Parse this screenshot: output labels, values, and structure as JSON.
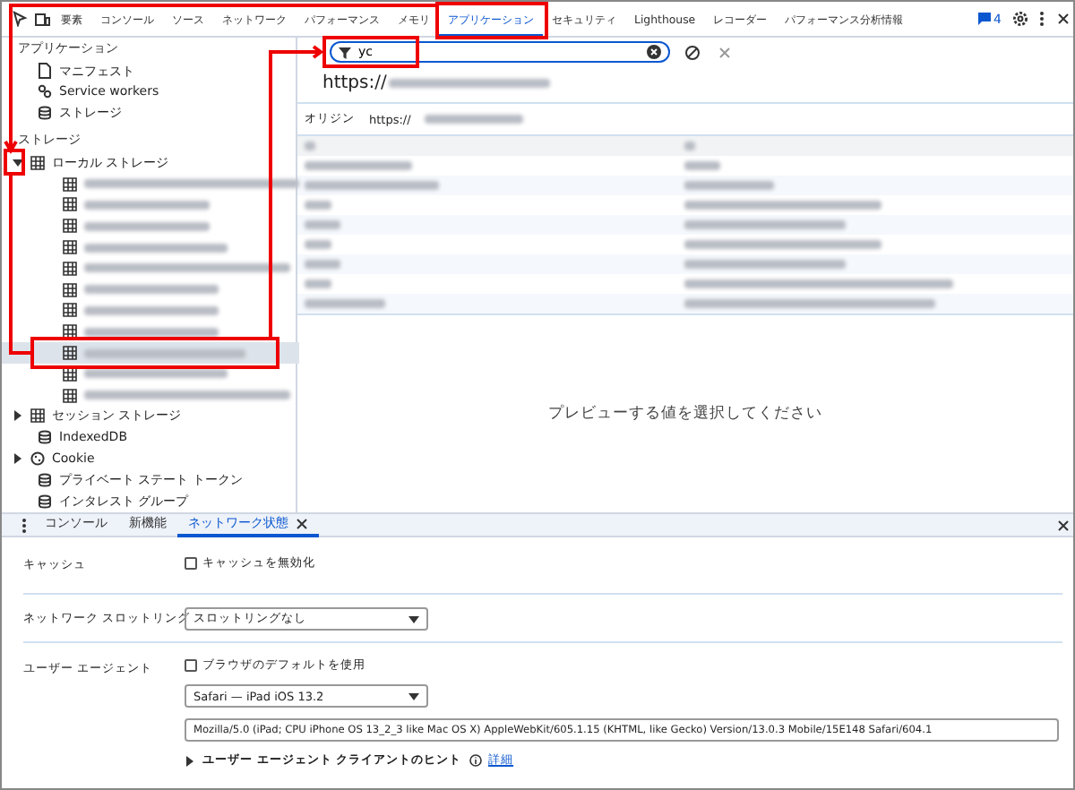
{
  "main_tabs": [
    {
      "label": "要素",
      "selected": false
    },
    {
      "label": "コンソール",
      "selected": false
    },
    {
      "label": "ソース",
      "selected": false
    },
    {
      "label": "ネットワーク",
      "selected": false
    },
    {
      "label": "パフォーマンス",
      "selected": false
    },
    {
      "label": "メモリ",
      "selected": false
    },
    {
      "label": "アプリケーション",
      "selected": true
    },
    {
      "label": "セキュリティ",
      "selected": false
    },
    {
      "label": "Lighthouse",
      "selected": false
    },
    {
      "label": "レコーダー",
      "selected": false
    },
    {
      "label": "パフォーマンス分析情報",
      "selected": false
    }
  ],
  "issues_count": "4",
  "sidebar": {
    "sections": [
      {
        "title": "アプリケーション",
        "items": [
          {
            "label": "マニフェスト",
            "kind": "file"
          },
          {
            "label": "Service workers",
            "kind": "worker"
          },
          {
            "label": "ストレージ",
            "kind": "database"
          }
        ]
      },
      {
        "title": "ストレージ",
        "items": [
          {
            "label": "ローカル ストレージ",
            "kind": "table",
            "expanded": true,
            "children": [
              {
                "selected": false
              },
              {
                "selected": false
              },
              {
                "selected": false
              },
              {
                "selected": false
              },
              {
                "selected": false
              },
              {
                "selected": false
              },
              {
                "selected": false
              },
              {
                "selected": false
              },
              {
                "selected": true
              },
              {
                "selected": false
              },
              {
                "selected": false
              }
            ]
          },
          {
            "label": "セッション ストレージ",
            "kind": "table",
            "expanded": false
          },
          {
            "label": "IndexedDB",
            "kind": "database"
          },
          {
            "label": "Cookie",
            "kind": "cookie",
            "expanded": false
          },
          {
            "label": "プライベート ステート トークン",
            "kind": "database"
          },
          {
            "label": "インタレスト グループ",
            "kind": "database"
          }
        ]
      }
    ]
  },
  "filter": {
    "value": "yc"
  },
  "origin_heading": "https://",
  "origin_label": "オリジン",
  "origin_value": "https://",
  "preview_message": "プレビューする値を選択してください",
  "drawer": {
    "tabs": [
      {
        "label": "コンソール",
        "selected": false,
        "closable": false
      },
      {
        "label": "新機能",
        "selected": false,
        "closable": false
      },
      {
        "label": "ネットワーク状態",
        "selected": true,
        "closable": true
      }
    ],
    "cache": {
      "label": "キャッシュ",
      "checkbox": "キャッシュを無効化",
      "checked": false
    },
    "throttling": {
      "label": "ネットワーク スロットリング",
      "value": "スロットリングなし"
    },
    "user_agent": {
      "label": "ユーザー エージェント",
      "checkbox": "ブラウザのデフォルトを使用",
      "checked": false,
      "preset": "Safari — iPad iOS 13.2",
      "string": "Mozilla/5.0 (iPad; CPU iPhone OS 13_2_3 like Mac OS X) AppleWebKit/605.1.15 (KHTML, like Gecko) Version/13.0.3 Mobile/15E148 Safari/604.1",
      "hints_label": "ユーザー エージェント クライアントのヒント",
      "hints_expanded": false,
      "link": "詳細"
    }
  }
}
